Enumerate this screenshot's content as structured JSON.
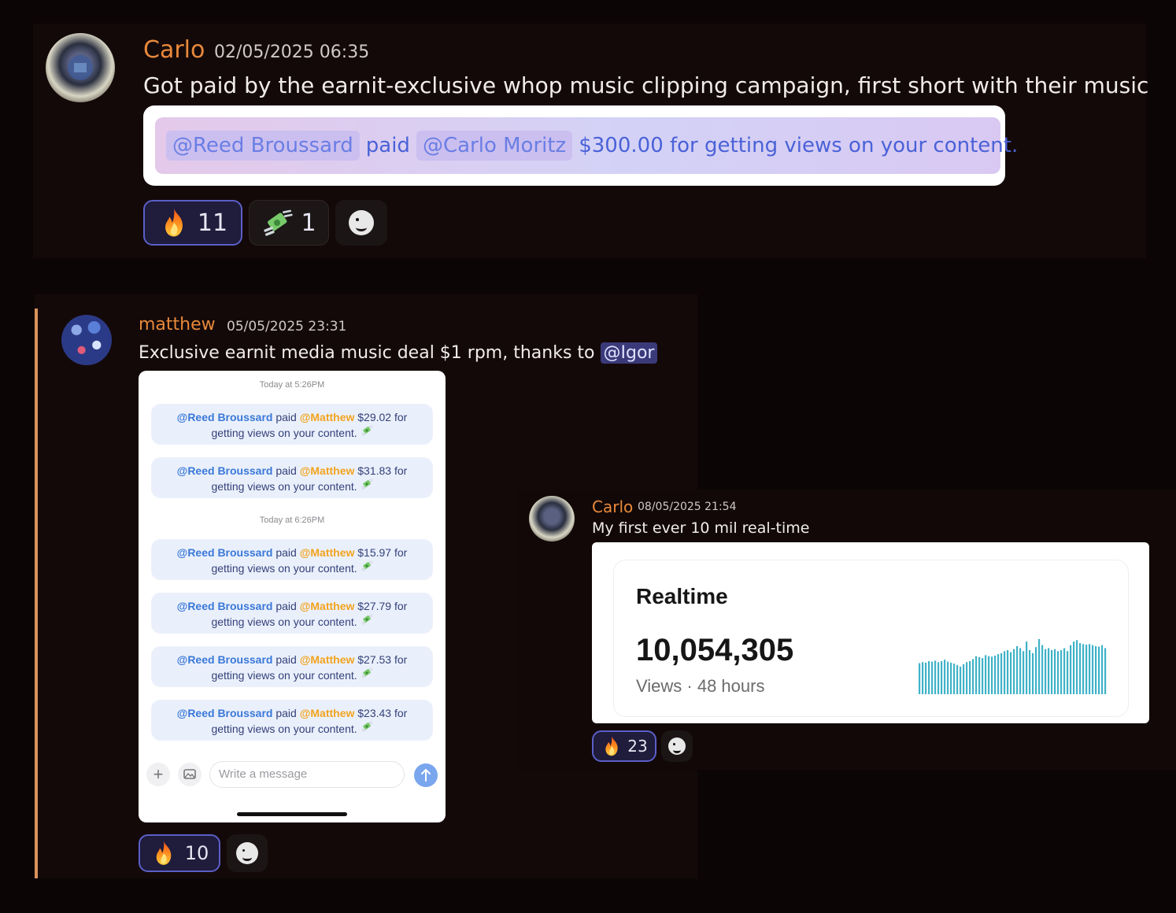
{
  "post1": {
    "username": "Carlo",
    "timestamp": "02/05/2025 06:35",
    "text": "Got paid by the earnit-exclusive whop music clipping campaign, first short with their music",
    "embed": {
      "payer": "@Reed Broussard",
      "verb": "paid",
      "payee": "@Carlo  Moritz",
      "message": "$300.00 for getting views on your content.",
      "icon": "money-with-wings-icon"
    },
    "reactions": [
      {
        "emoji": "fire-icon",
        "count": "11"
      },
      {
        "emoji": "money-with-wings-icon",
        "count": "1"
      }
    ]
  },
  "post2": {
    "username": "matthew",
    "timestamp": "05/05/2025 23:31",
    "text": "Exclusive earnit media music deal $1 rpm, thanks to",
    "mention": "@Igor",
    "screenshot": {
      "day_labels": [
        "Today at 5:26PM",
        "Today at 6:26PM"
      ],
      "payer": "@Reed Broussard",
      "verb": "paid",
      "payee": "@Matthew",
      "suffix": "getting views on your content.",
      "payments": [
        {
          "amount": "$29.02 for"
        },
        {
          "amount": "$31.83 for"
        },
        {
          "amount": "$15.97 for"
        },
        {
          "amount": "$27.79 for"
        },
        {
          "amount": "$27.53 for"
        },
        {
          "amount": "$23.43 for"
        }
      ],
      "composer_placeholder": "Write a message"
    },
    "reactions": [
      {
        "emoji": "fire-icon",
        "count": "10"
      }
    ]
  },
  "post3": {
    "username": "Carlo",
    "timestamp": "08/05/2025 21:54",
    "text": "My first ever 10 mil real-time",
    "card": {
      "title": "Realtime",
      "value": "10,054,305",
      "caption": "Views · 48 hours",
      "bars": [
        0.62,
        0.64,
        0.63,
        0.66,
        0.65,
        0.67,
        0.64,
        0.66,
        0.69,
        0.65,
        0.63,
        0.61,
        0.58,
        0.55,
        0.6,
        0.64,
        0.66,
        0.7,
        0.76,
        0.74,
        0.72,
        0.78,
        0.76,
        0.75,
        0.77,
        0.8,
        0.82,
        0.86,
        0.88,
        0.84,
        0.9,
        0.96,
        0.92,
        0.86,
        1.05,
        0.88,
        0.82,
        0.94,
        1.1,
        0.98,
        0.9,
        0.92,
        0.88,
        0.9,
        0.86,
        0.88,
        0.92,
        0.86,
        0.98,
        1.05,
        1.08,
        1.02,
        1.0,
        0.99,
        1.0,
        0.98,
        0.96,
        0.95,
        0.98,
        0.92
      ],
      "bar_color": "#3fb2c8"
    },
    "reactions": [
      {
        "emoji": "fire-icon",
        "count": "23"
      }
    ]
  },
  "colors": {
    "accent": "#5b5fc7",
    "username": "#e8893b",
    "mention_bg": "#3a3a7a",
    "reply_bar": "#d9935a"
  }
}
